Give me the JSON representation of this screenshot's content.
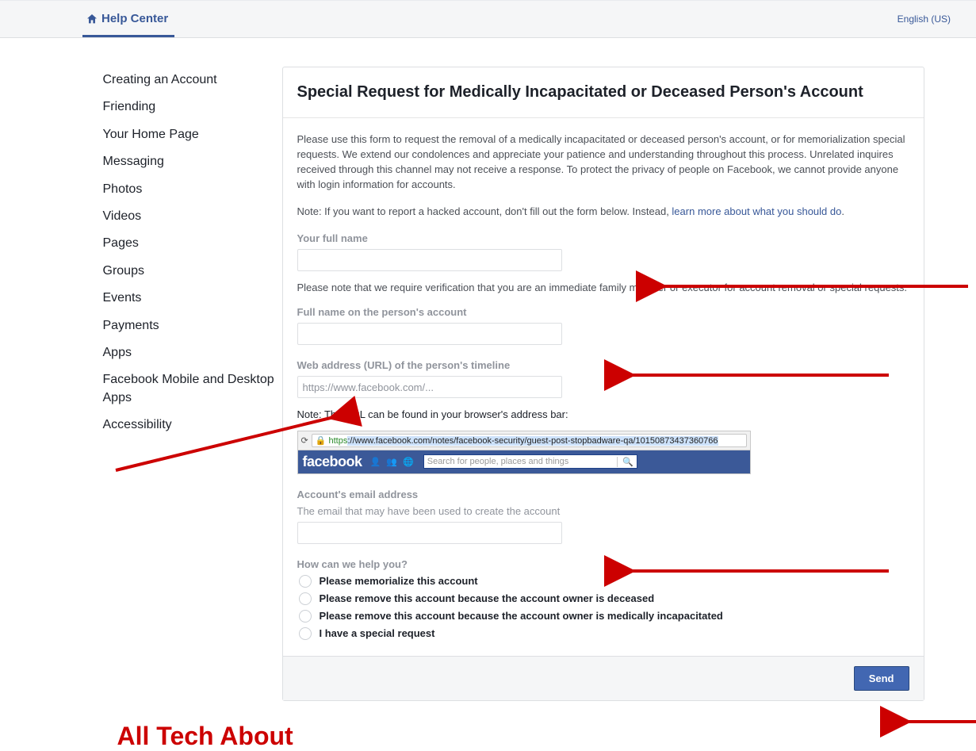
{
  "header": {
    "help_center": "Help Center",
    "language": "English (US)"
  },
  "sidebar": {
    "items": [
      "Creating an Account",
      "Friending",
      "Your Home Page",
      "Messaging",
      "Photos",
      "Videos",
      "Pages",
      "Groups",
      "Events",
      "Payments",
      "Apps",
      "Facebook Mobile and Desktop Apps",
      "Accessibility"
    ]
  },
  "card": {
    "title": "Special Request for Medically Incapacitated or Deceased Person's Account",
    "intro": "Please use this form to request the removal of a medically incapacitated or deceased person's account, or for memorialization special requests. We extend our condolences and appreciate your patience and understanding throughout this process. Unrelated inquires received through this channel may not receive a response. To protect the privacy of people on Facebook, we cannot provide anyone with login information for accounts.",
    "note_prefix": "Note: If you want to report a hacked account, don't fill out the form below. Instead, ",
    "note_link": "learn more about what you should do",
    "note_suffix": ".",
    "fields": {
      "full_name_label": "Your full name",
      "full_name_help": "Please note that we require verification that you are an immediate family member or executor for account removal or special requests.",
      "person_name_label": "Full name on the person's account",
      "url_label": "Web address (URL) of the person's timeline",
      "url_placeholder": "https://www.facebook.com/...",
      "url_help": "Note: The URL can be found in your browser's address bar:",
      "email_label": "Account's email address",
      "email_sublabel": "The email that may have been used to create the account",
      "help_label": "How can we help you?",
      "radios": [
        "Please memorialize this account",
        "Please remove this account because the account owner is deceased",
        "Please remove this account because the account owner is medically incapacitated",
        "I have a special request"
      ]
    },
    "example": {
      "https": "https",
      "rest": "://www.facebook.com/notes/facebook-security/guest-post-stopbadware-qa/10150873437360766",
      "fb_logo": "facebook",
      "search_placeholder": "Search for people, places and things"
    },
    "send": "Send"
  },
  "annotation": {
    "brand": "All Tech About"
  }
}
